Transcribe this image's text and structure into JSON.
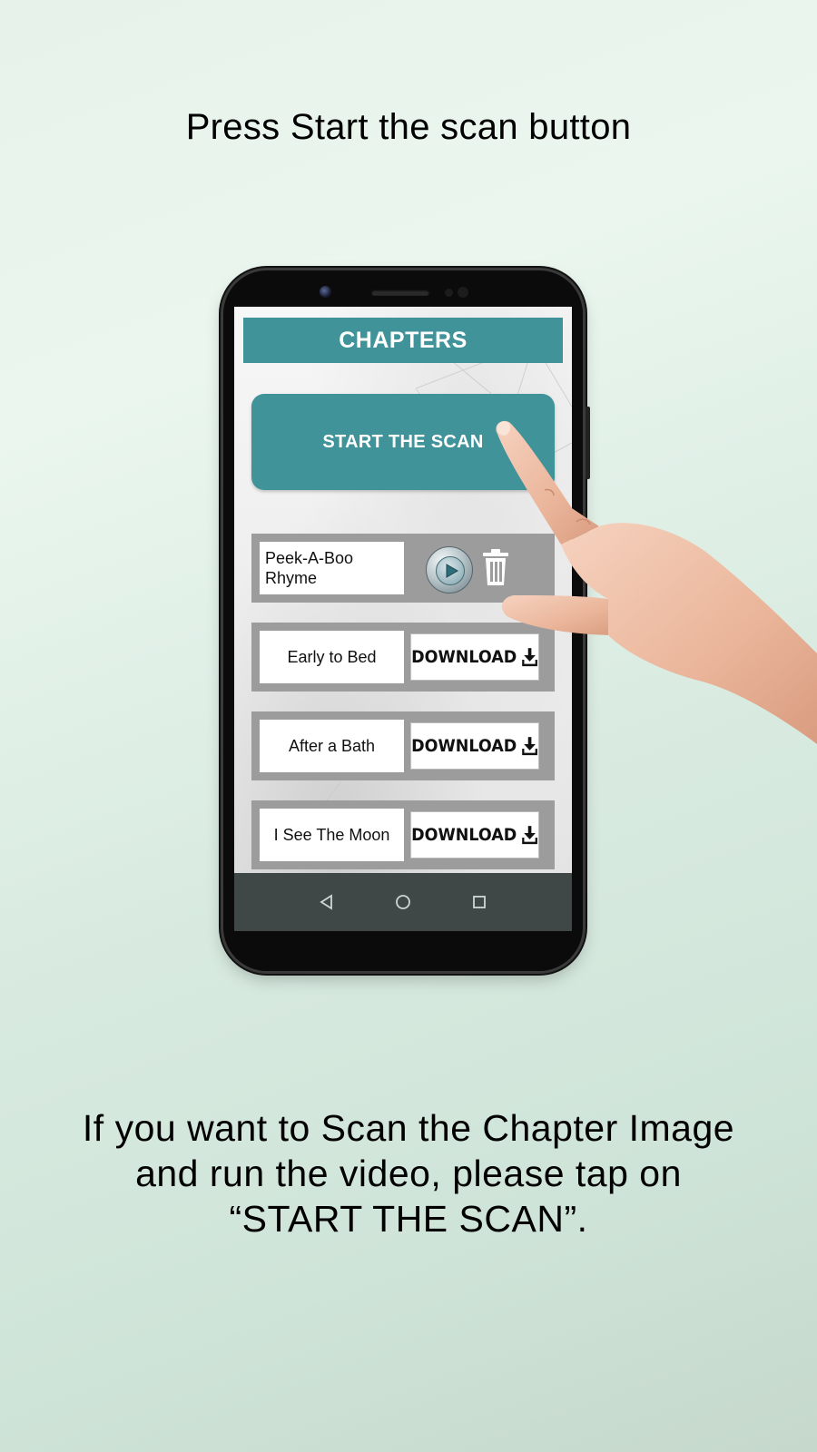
{
  "headline": "Press Start the scan button",
  "caption": {
    "line1": "If you want to Scan the Chapter Image",
    "line2": "and run the video, please tap on",
    "line3": "“START THE SCAN”."
  },
  "app": {
    "header_title": "CHAPTERS",
    "scan_button_label": "START THE SCAN",
    "chapters": [
      {
        "title_line1": "Peek-A-Boo",
        "title_line2": "Rhyme",
        "state": "downloaded",
        "actions": [
          "play-icon",
          "trash-icon"
        ]
      },
      {
        "title": "Early to Bed",
        "action_label": "DOWNLOAD",
        "icon": "download-icon"
      },
      {
        "title": "After a Bath",
        "action_label": "DOWNLOAD",
        "icon": "download-icon"
      },
      {
        "title": "I See The Moon",
        "action_label": "DOWNLOAD",
        "icon": "download-icon"
      }
    ],
    "navbar": [
      "back-icon",
      "home-icon",
      "recents-icon"
    ]
  },
  "colors": {
    "accent": "#3f9399",
    "row_bg": "#9c9c9c",
    "navbar_bg": "#3f4747"
  }
}
